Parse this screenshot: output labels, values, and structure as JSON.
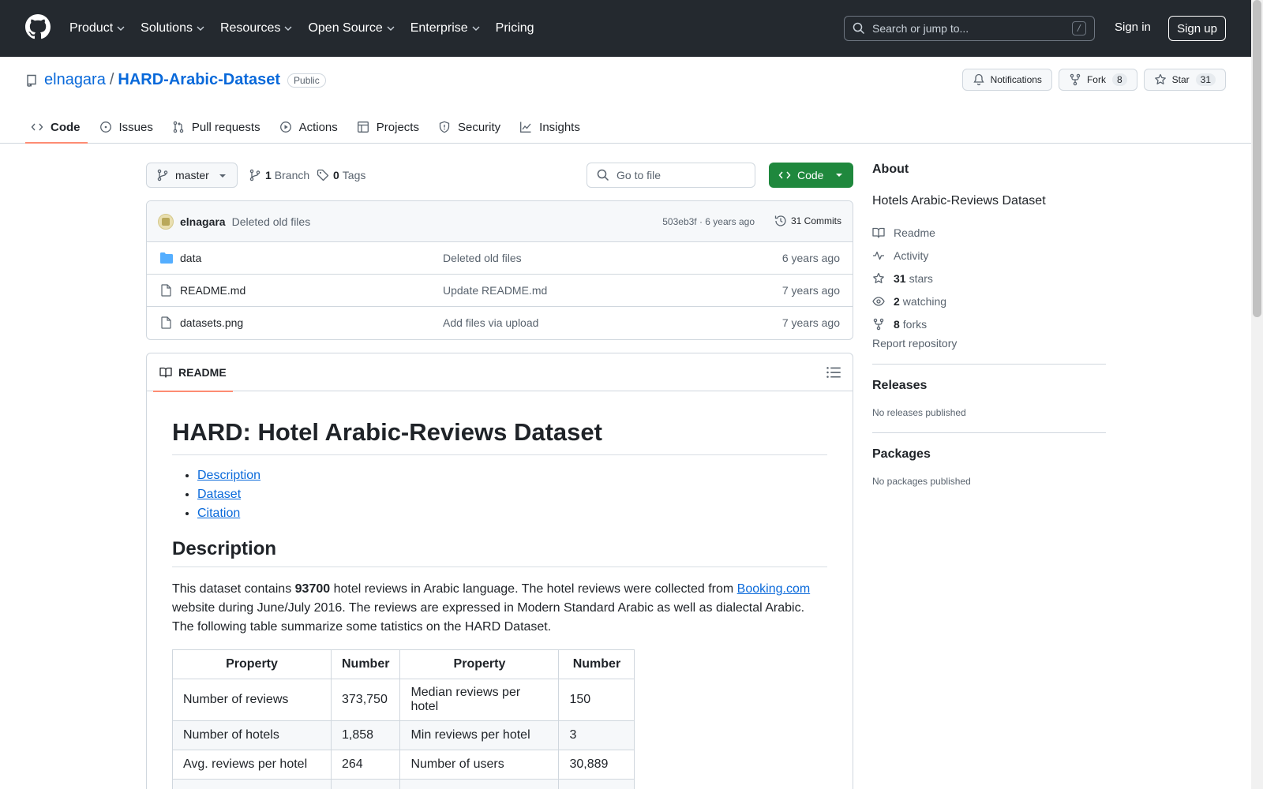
{
  "header": {
    "nav": [
      "Product",
      "Solutions",
      "Resources",
      "Open Source",
      "Enterprise",
      "Pricing"
    ],
    "search_placeholder": "Search or jump to...",
    "search_shortcut": "/",
    "sign_in": "Sign in",
    "sign_up": "Sign up"
  },
  "repo": {
    "owner": "elnagara",
    "separator": "/",
    "name": "HARD-Arabic-Dataset",
    "visibility": "Public",
    "notifications_label": "Notifications",
    "fork_label": "Fork",
    "fork_count": "8",
    "star_label": "Star",
    "star_count": "31"
  },
  "tabs": [
    {
      "label": "Code",
      "icon": "code-icon"
    },
    {
      "label": "Issues",
      "icon": "issue-icon"
    },
    {
      "label": "Pull requests",
      "icon": "pull-request-icon"
    },
    {
      "label": "Actions",
      "icon": "play-icon"
    },
    {
      "label": "Projects",
      "icon": "table-icon"
    },
    {
      "label": "Security",
      "icon": "shield-icon"
    },
    {
      "label": "Insights",
      "icon": "graph-icon"
    }
  ],
  "toolbar": {
    "branch": "master",
    "branch_count": "1",
    "branch_label": "Branch",
    "tag_count": "0",
    "tag_label": "Tags",
    "goto_placeholder": "Go to file",
    "code_button": "Code"
  },
  "commit": {
    "author": "elnagara",
    "message": "Deleted old files",
    "meta": "503eb3f · 6 years ago",
    "commits_label": "31 Commits"
  },
  "files": [
    {
      "name": "data",
      "type": "folder",
      "message": "Deleted old files",
      "date": "6 years ago"
    },
    {
      "name": "README.md",
      "type": "file",
      "message": "Update README.md",
      "date": "7 years ago"
    },
    {
      "name": "datasets.png",
      "type": "file",
      "message": "Add files via upload",
      "date": "7 years ago"
    }
  ],
  "readme": {
    "tab_label": "README",
    "title": "HARD: Hotel Arabic-Reviews Dataset",
    "toc": [
      "Description",
      "Dataset",
      "Citation"
    ],
    "description_heading": "Description",
    "para_1": "This dataset contains ",
    "para_bold": "93700",
    "para_2": " hotel reviews in Arabic language. The hotel reviews were collected from ",
    "para_link": "Booking.com",
    "para_3": " website during June/July 2016. The reviews are expressed in Modern Standard Arabic as well as dialectal Arabic. The following table summarize some tatistics on the HARD Dataset.",
    "table": {
      "headers": [
        "Property",
        "Number",
        "Property",
        "Number"
      ],
      "rows": [
        [
          "Number of reviews",
          "373,750",
          "Median reviews per hotel",
          "150"
        ],
        [
          "Number of hotels",
          "1,858",
          "Min reviews per hotel",
          "3"
        ],
        [
          "Avg. reviews per hotel",
          "264",
          "Number of users",
          "30,889"
        ],
        [
          "",
          "",
          "",
          ""
        ]
      ]
    }
  },
  "sidebar": {
    "about_heading": "About",
    "description": "Hotels Arabic-Reviews Dataset",
    "readme": "Readme",
    "activity": "Activity",
    "stars_count": "31",
    "stars_label": "stars",
    "watching_count": "2",
    "watching_label": "watching",
    "forks_count": "8",
    "forks_label": "forks",
    "report": "Report repository",
    "releases_heading": "Releases",
    "releases_none": "No releases published",
    "packages_heading": "Packages",
    "packages_none": "No packages published"
  }
}
